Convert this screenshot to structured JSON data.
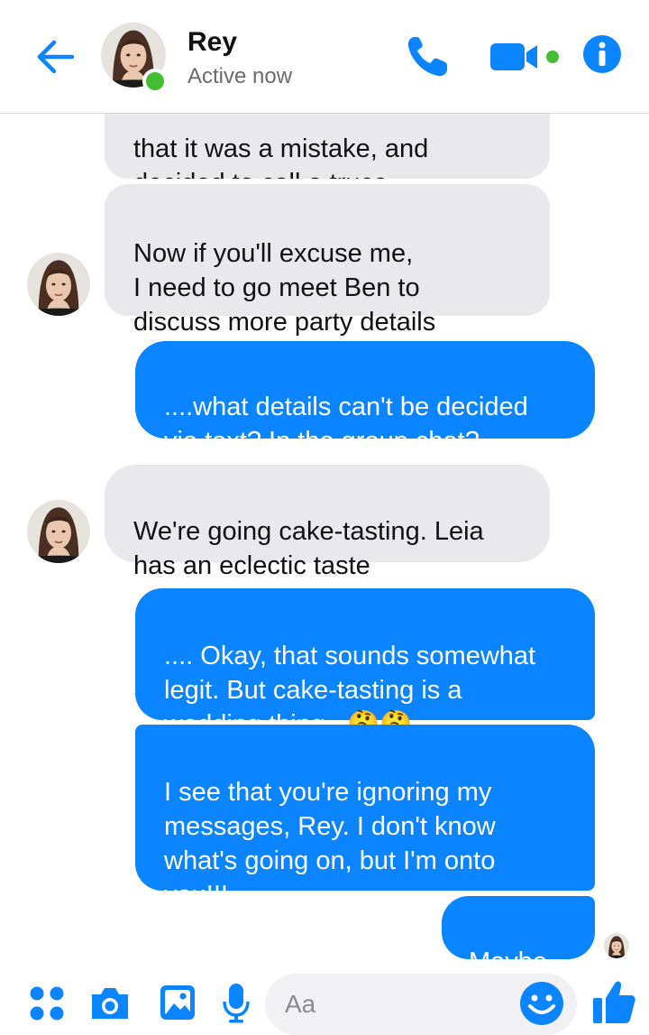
{
  "header": {
    "contact_name": "Rey",
    "status": "Active now",
    "icons": [
      "back-arrow-icon",
      "phone-icon",
      "video-camera-icon",
      "info-icon"
    ]
  },
  "messages": [
    {
      "side": "incoming",
      "text": "that it was a mistake, and\ndecided to call a truce"
    },
    {
      "side": "incoming",
      "text": "Now if you'll excuse me,\nI need to go meet Ben to\ndiscuss more party details"
    },
    {
      "side": "outgoing",
      "text": "....what details can't be decided\nvia text? In the group chat?"
    },
    {
      "side": "incoming",
      "text": "We're going cake-tasting. Leia\nhas an eclectic taste"
    },
    {
      "side": "outgoing",
      "text": ".... Okay, that sounds somewhat\nlegit. But cake-tasting is a\nwedding thing...",
      "emoji": "🤔🤔"
    },
    {
      "side": "outgoing",
      "text": "I see that you're ignoring my\nmessages, Rey. I don't know\nwhat's going on, but I'm onto\nyou!!!"
    },
    {
      "side": "outgoing",
      "text": "Maybe."
    }
  ],
  "composer": {
    "placeholder": "Aa",
    "icons": [
      "apps-icon",
      "camera-icon",
      "image-icon",
      "microphone-icon",
      "emoji-icon",
      "thumbs-up-icon"
    ]
  },
  "colors": {
    "accent": "#0a84ff",
    "incoming_bubble": "#e9e9eb",
    "active": "#44bd32"
  }
}
